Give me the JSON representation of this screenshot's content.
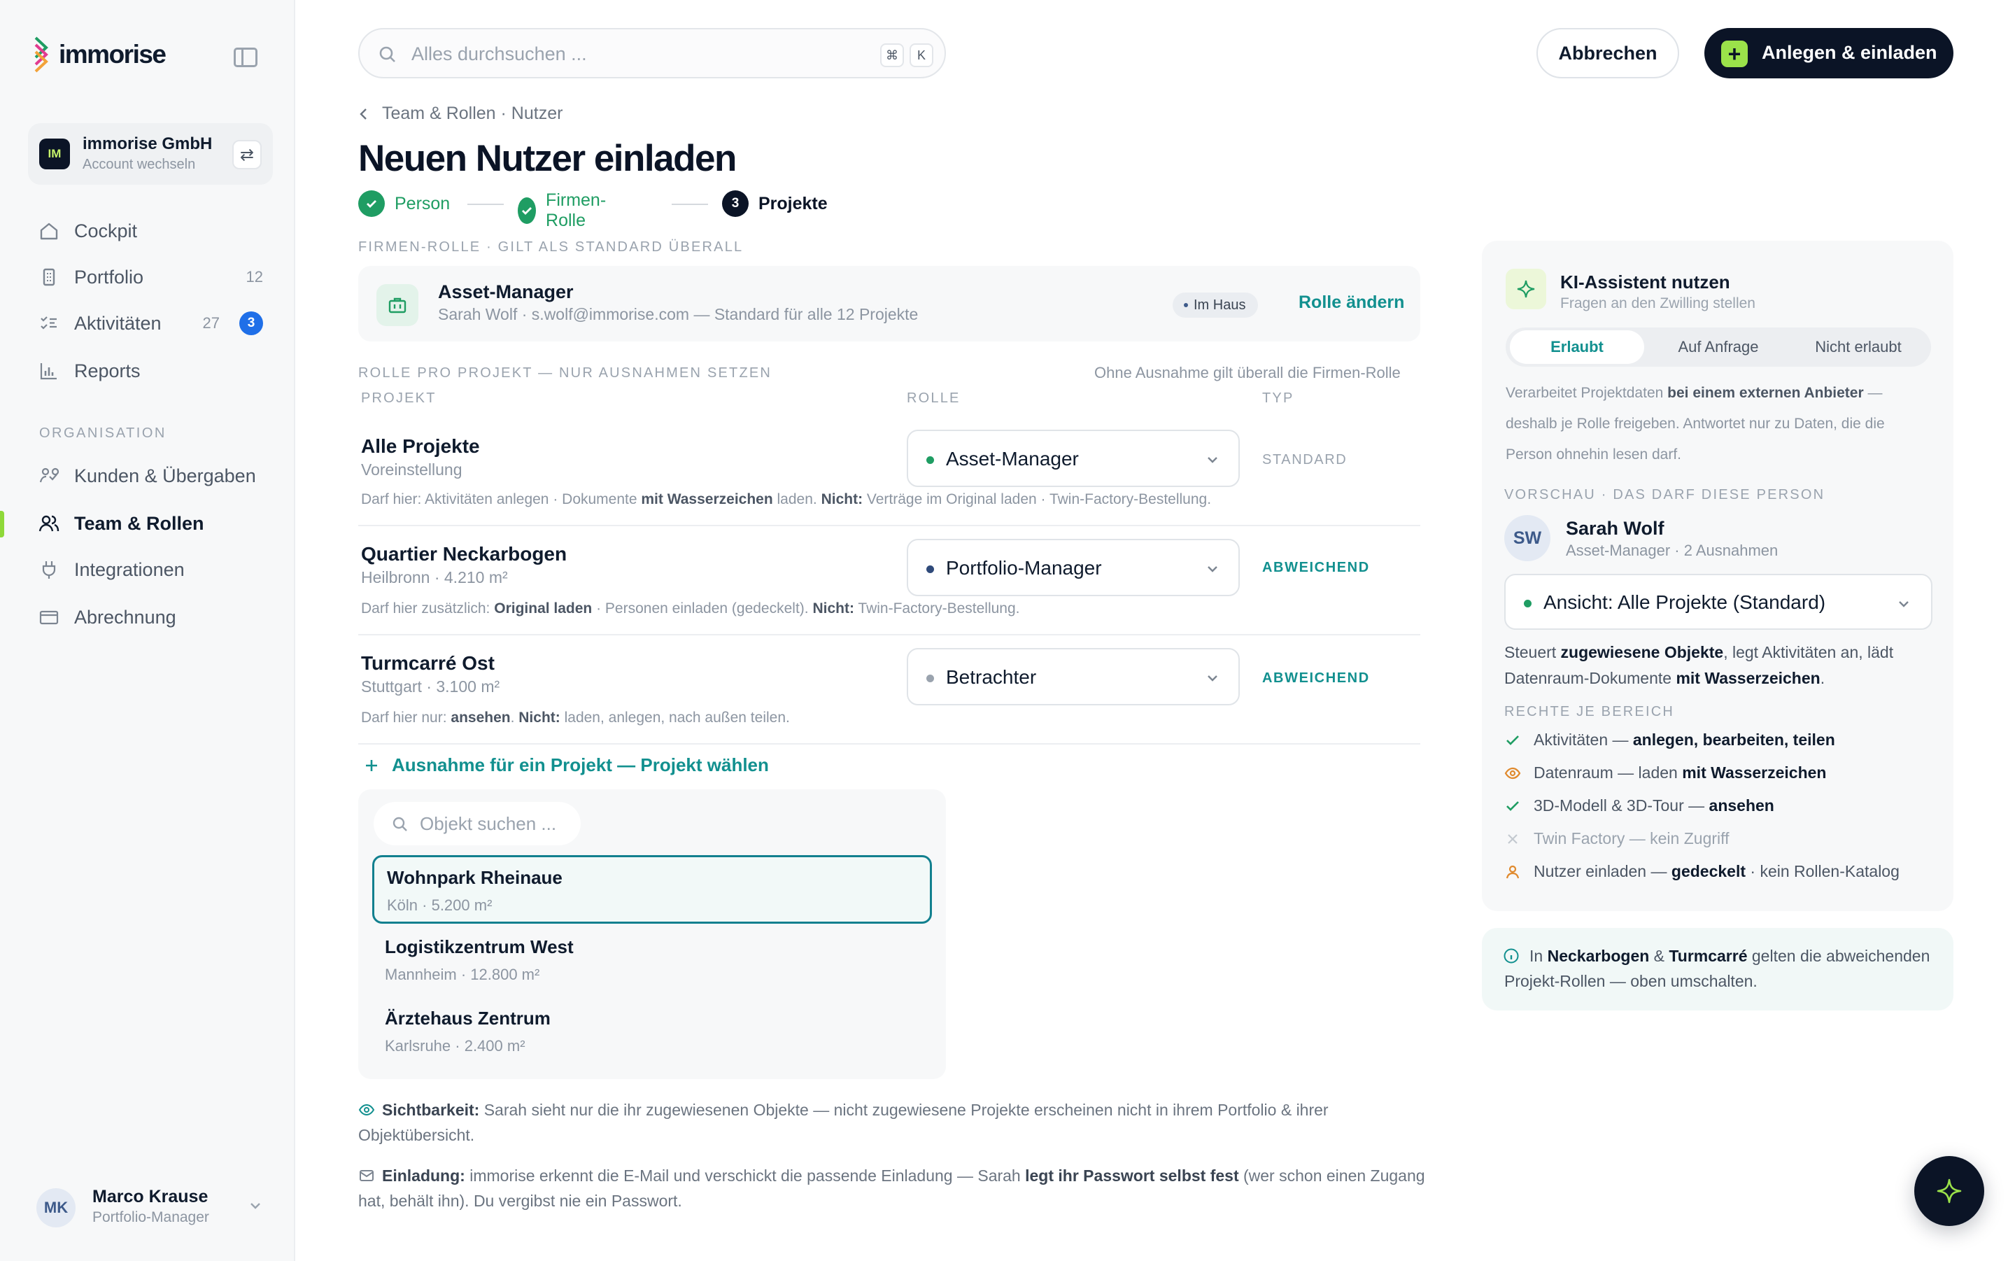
{
  "sidebar": {
    "logo": "immorise",
    "account": {
      "initials": "IM",
      "name": "immorise GmbH",
      "action": "Account wechseln"
    },
    "nav": [
      {
        "label": "Cockpit",
        "icon": "home-icon"
      },
      {
        "label": "Portfolio",
        "icon": "building-icon",
        "count": "12"
      },
      {
        "label": "Aktivitäten",
        "icon": "checklist-icon",
        "count": "27",
        "badge": "3"
      },
      {
        "label": "Reports",
        "icon": "bar-chart-icon"
      }
    ],
    "section_label": "ORGANISATION",
    "org_nav": [
      {
        "label": "Kunden & Übergaben",
        "icon": "handshake-icon"
      },
      {
        "label": "Team & Rollen",
        "icon": "users-icon",
        "active": true
      },
      {
        "label": "Integrationen",
        "icon": "plug-icon"
      },
      {
        "label": "Abrechnung",
        "icon": "credit-card-icon"
      }
    ],
    "user": {
      "initials": "MK",
      "name": "Marco Krause",
      "role": "Portfolio-Manager"
    }
  },
  "topbar": {
    "search_placeholder": "Alles durchsuchen ...",
    "shortcut_keys": [
      "⌘",
      "K"
    ],
    "cancel_label": "Abbrechen",
    "primary_label": "Anlegen & einladen"
  },
  "main": {
    "breadcrumb": "Team & Rollen · Nutzer",
    "title": "Neuen Nutzer einladen",
    "steps": [
      {
        "label": "Person",
        "state": "done"
      },
      {
        "label": "Firmen-Rolle",
        "state": "done"
      },
      {
        "number": "3",
        "label": "Projekte",
        "state": "current"
      }
    ],
    "company_role_label": "FIRMEN-ROLLE · GILT ALS STANDARD ÜBERALL",
    "company_role": {
      "name": "Asset-Manager",
      "sub": "Sarah Wolf · s.wolf@immorise.com — Standard für alle 12 Projekte",
      "tag": "Im Haus",
      "change_label": "Rolle ändern"
    },
    "project_role_label": "ROLLE PRO PROJEKT — NUR AUSNAHMEN SETZEN",
    "project_role_note": "Ohne Ausnahme gilt überall die Firmen-Rolle",
    "columns": {
      "project": "PROJEKT",
      "role": "ROLLE",
      "type": "TYP"
    },
    "projects": [
      {
        "name": "Alle Projekte",
        "sub": "Voreinstellung",
        "role": "Asset-Manager",
        "role_color": "#1f9d63",
        "type": "STANDARD",
        "desc": [
          {
            "t": "Darf hier: Aktivitäten anlegen · Dokumente "
          },
          {
            "t": "mit Wasserzeichen",
            "b": true
          },
          {
            "t": " laden. "
          },
          {
            "t": "Nicht:",
            "b": true
          },
          {
            "t": " Verträge im Original laden · Twin-Factory-Bestellung."
          }
        ]
      },
      {
        "name": "Quartier Neckarbogen",
        "sub": "Heilbronn · 4.210 m²",
        "role": "Portfolio-Manager",
        "role_color": "#2f4a7a",
        "type": "ABWEICHEND",
        "desc": [
          {
            "t": "Darf hier zusätzlich: "
          },
          {
            "t": "Original laden",
            "b": true
          },
          {
            "t": " · Personen einladen (gedeckelt). "
          },
          {
            "t": "Nicht:",
            "b": true
          },
          {
            "t": " Twin-Factory-Bestellung."
          }
        ]
      },
      {
        "name": "Turmcarré Ost",
        "sub": "Stuttgart · 3.100 m²",
        "role": "Betrachter",
        "role_color": "#9aa3ae",
        "type": "ABWEICHEND",
        "desc": [
          {
            "t": "Darf hier nur: "
          },
          {
            "t": "ansehen",
            "b": true
          },
          {
            "t": ". "
          },
          {
            "t": "Nicht:",
            "b": true
          },
          {
            "t": " laden, anlegen, nach außen teilen."
          }
        ]
      }
    ],
    "add_exception_label": "Ausnahme für ein Projekt — Projekt wählen",
    "object_search_placeholder": "Objekt suchen ...",
    "objects": [
      {
        "name": "Wohnpark Rheinaue",
        "sub": "Köln · 5.200 m²",
        "selected": true
      },
      {
        "name": "Logistikzentrum West",
        "sub": "Mannheim · 12.800 m²"
      },
      {
        "name": "Ärztehaus Zentrum",
        "sub": "Karlsruhe · 2.400 m²"
      }
    ],
    "visibility": [
      {
        "t": "Sichtbarkeit:",
        "b": true
      },
      {
        "t": " Sarah sieht nur die ihr zugewiesenen Objekte — nicht zugewiesene Projekte erscheinen nicht in ihrem Portfolio & ihrer Objektübersicht."
      }
    ],
    "invitation": [
      {
        "t": "Einladung:",
        "b": true
      },
      {
        "t": " immorise erkennt die E-Mail und verschickt die passende Einladung — Sarah "
      },
      {
        "t": "legt ihr Passwort selbst fest",
        "b": true
      },
      {
        "t": " (wer schon einen Zugang hat, behält ihn). Du vergibst nie ein Passwort."
      }
    ]
  },
  "panel": {
    "ki_title": "KI-Assistent nutzen",
    "ki_sub": "Fragen an den Zwilling stellen",
    "segments": [
      {
        "label": "Erlaubt",
        "on": true
      },
      {
        "label": "Auf Anfrage"
      },
      {
        "label": "Nicht erlaubt"
      }
    ],
    "ki_desc": [
      {
        "t": "Verarbeitet Projektdaten "
      },
      {
        "t": "bei einem externen Anbieter",
        "b": true
      },
      {
        "t": " — deshalb je Rolle freigeben. Antwortet nur zu Daten, die die Person ohnehin lesen darf."
      }
    ],
    "preview_label": "VORSCHAU · DAS DARF DIESE PERSON",
    "person": {
      "initials": "SW",
      "name": "Sarah Wolf",
      "sub": "Asset-Manager · 2 Ausnahmen"
    },
    "view_select": "Ansicht: Alle Projekte (Standard)",
    "preview_desc": [
      {
        "t": "Steuert "
      },
      {
        "t": "zugewiesene Objekte",
        "b": true
      },
      {
        "t": ", legt Aktivitäten an, lädt Datenraum-Dokumente "
      },
      {
        "t": "mit Wasserzeichen",
        "b": true
      },
      {
        "t": "."
      }
    ],
    "rights_label": "RECHTE JE BEREICH",
    "rights": [
      {
        "icon": "check-icon",
        "state": "on",
        "parts": [
          {
            "t": "Aktivitäten — "
          },
          {
            "t": "anlegen, bearbeiten, teilen",
            "b": true
          }
        ]
      },
      {
        "icon": "eye-icon",
        "state": "partial",
        "parts": [
          {
            "t": "Datenraum — laden "
          },
          {
            "t": "mit Wasserzeichen",
            "b": true
          }
        ]
      },
      {
        "icon": "check-icon",
        "state": "on",
        "parts": [
          {
            "t": "3D-Modell & 3D-Tour — "
          },
          {
            "t": "ansehen",
            "b": true
          }
        ]
      },
      {
        "icon": "x-icon",
        "state": "off",
        "parts": [
          {
            "t": "Twin Factory — kein Zugriff"
          }
        ]
      },
      {
        "icon": "user-icon",
        "state": "partial",
        "parts": [
          {
            "t": "Nutzer einladen — "
          },
          {
            "t": "gedeckelt",
            "b": true
          },
          {
            "t": " · kein Rollen-Katalog"
          }
        ]
      }
    ],
    "hint": [
      {
        "t": "In "
      },
      {
        "t": "Neckarbogen",
        "b": true
      },
      {
        "t": " & "
      },
      {
        "t": "Turmcarré",
        "b": true
      },
      {
        "t": " gelten die abweichenden Projekt-Rollen — oben umschalten."
      }
    ]
  },
  "colors": {
    "accent": "#12908f",
    "success": "#1f9d63",
    "dark": "#0b1426",
    "lime": "#9be24a",
    "badge": "#1f6fe8",
    "warning": "#e08a2e"
  }
}
